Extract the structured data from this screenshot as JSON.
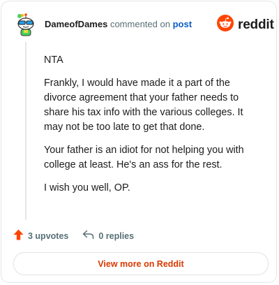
{
  "comment": {
    "username": "DameofDames",
    "action_text": "commented on",
    "post_link": "post",
    "paragraphs": [
      "NTA",
      "Frankly, I would have made it a part of the divorce agreement that your father needs to share his tax info with the various colleges. It may not be too late to get that done.",
      "Your father is an idiot for not helping you with college at least. He's an ass for the rest.",
      "I wish you well, OP."
    ]
  },
  "brand": {
    "name": "reddit",
    "icon": "reddit-snoo-icon",
    "color": "#ff4500"
  },
  "actions": {
    "upvotes": "3 upvotes",
    "replies": "0 replies",
    "upvote_icon": "upvote-arrow-icon",
    "reply_icon": "reply-arrow-icon"
  },
  "footer": {
    "view_more": "View more on Reddit"
  },
  "colors": {
    "accent": "#ff4500",
    "link": "#0b5fc5",
    "button_text": "#d93900"
  }
}
